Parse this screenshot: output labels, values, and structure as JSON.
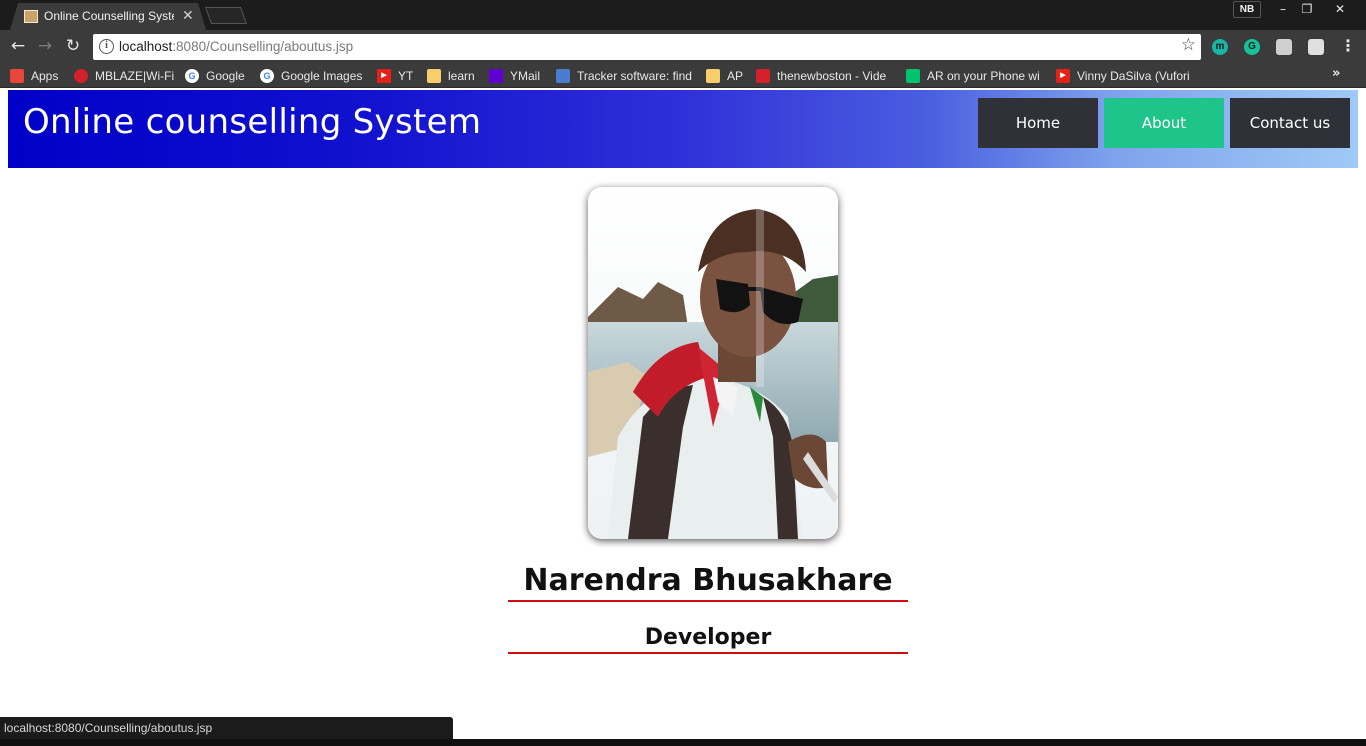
{
  "browser": {
    "tab_title": "Online Counselling System",
    "profile": "NB",
    "url_host": "localhost",
    "url_path": ":8080/Counselling/aboutus.jsp",
    "status_url": "localhost:8080/Counselling/aboutus.jsp",
    "bookmarks": [
      {
        "label": "Apps",
        "icon": "apps-grid-icon",
        "color": "#e8453c"
      },
      {
        "label": "MBLAZE|Wi-Fi",
        "icon": "opera-icon",
        "color": "#d3202b"
      },
      {
        "label": "Google",
        "icon": "google-icon",
        "color": "#ffffff"
      },
      {
        "label": "Google Images",
        "icon": "google-icon",
        "color": "#ffffff"
      },
      {
        "label": "YT",
        "icon": "youtube-icon",
        "color": "#e62117"
      },
      {
        "label": "learn",
        "icon": "folder-icon",
        "color": "#f7cf6a"
      },
      {
        "label": "YMail",
        "icon": "yahoo-mail-icon",
        "color": "#5f01d1"
      },
      {
        "label": "Tracker software: find",
        "icon": "tracker-icon",
        "color": "#4a7bd0"
      },
      {
        "label": "AP",
        "icon": "folder-icon",
        "color": "#f7cf6a"
      },
      {
        "label": "thenewboston - Vide",
        "icon": "thenewboston-icon",
        "color": "#d3202b"
      },
      {
        "label": "AR on your Phone wi",
        "icon": "medium-icon",
        "color": "#00c36c"
      },
      {
        "label": "Vinny DaSilva (Vufori",
        "icon": "youtube-icon",
        "color": "#e62117"
      }
    ],
    "extensions": [
      {
        "icon": "m-extension-icon",
        "letter": "m",
        "color": "#19b5a5"
      },
      {
        "icon": "grammarly-icon",
        "letter": "G",
        "color": "#15c39a"
      },
      {
        "icon": "mail-extension-icon",
        "letter": "",
        "color": "#cfcfcf"
      },
      {
        "icon": "cube-extension-icon",
        "letter": "",
        "color": "#e0e0e0"
      }
    ]
  },
  "site": {
    "title": "Online counselling System",
    "nav": [
      {
        "label": "Home",
        "active": false
      },
      {
        "label": "About",
        "active": true
      },
      {
        "label": "Contact us",
        "active": false
      }
    ]
  },
  "profile": {
    "name": "Narendra Bhusakhare",
    "role": "Developer"
  }
}
